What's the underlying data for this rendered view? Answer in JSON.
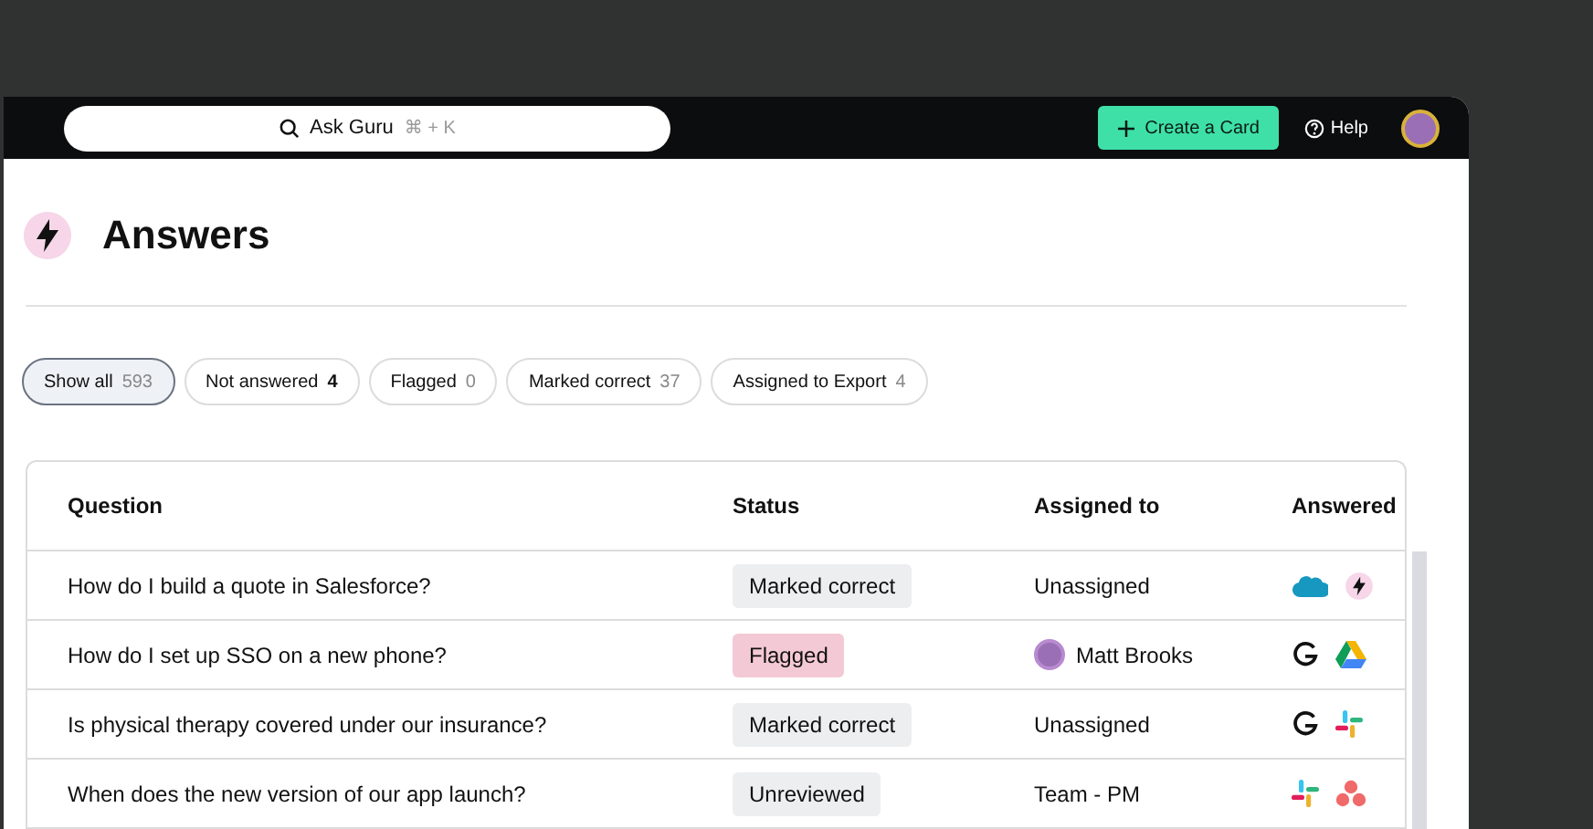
{
  "topbar": {
    "search": {
      "placeholder": "Ask Guru",
      "shortcut": "⌘ + K"
    },
    "create_button": "Create a Card",
    "help": "Help"
  },
  "page": {
    "title": "Answers"
  },
  "filters": [
    {
      "label": "Show all",
      "count": "593",
      "selected": true,
      "emphasis": false
    },
    {
      "label": "Not answered",
      "count": "4",
      "selected": false,
      "emphasis": true
    },
    {
      "label": "Flagged",
      "count": "0",
      "selected": false,
      "emphasis": false
    },
    {
      "label": "Marked correct",
      "count": "37",
      "selected": false,
      "emphasis": false
    },
    {
      "label": "Assigned to Export",
      "count": "4",
      "selected": false,
      "emphasis": false
    }
  ],
  "table": {
    "columns": [
      "Question",
      "Status",
      "Assigned to",
      "Answered"
    ],
    "rows": [
      {
        "question": "How do I build a quote in Salesforce?",
        "status": {
          "label": "Marked correct",
          "kind": "correct"
        },
        "assigned": {
          "name": "Unassigned",
          "avatar": false
        },
        "sources": [
          {
            "kind": "cloud"
          },
          {
            "kind": "bolt"
          }
        ]
      },
      {
        "question": "How do I set up SSO on a new phone?",
        "status": {
          "label": "Flagged",
          "kind": "flagged"
        },
        "assigned": {
          "name": "Matt Brooks",
          "avatar": true
        },
        "sources": [
          {
            "kind": "g"
          },
          {
            "kind": "drive"
          }
        ]
      },
      {
        "question": "Is physical therapy covered under our insurance?",
        "status": {
          "label": "Marked correct",
          "kind": "correct"
        },
        "assigned": {
          "name": "Unassigned",
          "avatar": false
        },
        "sources": [
          {
            "kind": "g"
          },
          {
            "kind": "hash"
          }
        ]
      },
      {
        "question": "When does the new version of our app launch?",
        "status": {
          "label": "Unreviewed",
          "kind": "unreviewed"
        },
        "assigned": {
          "name": "Team - PM",
          "avatar": false
        },
        "sources": [
          {
            "kind": "hash"
          },
          {
            "kind": "dots"
          }
        ]
      }
    ]
  }
}
